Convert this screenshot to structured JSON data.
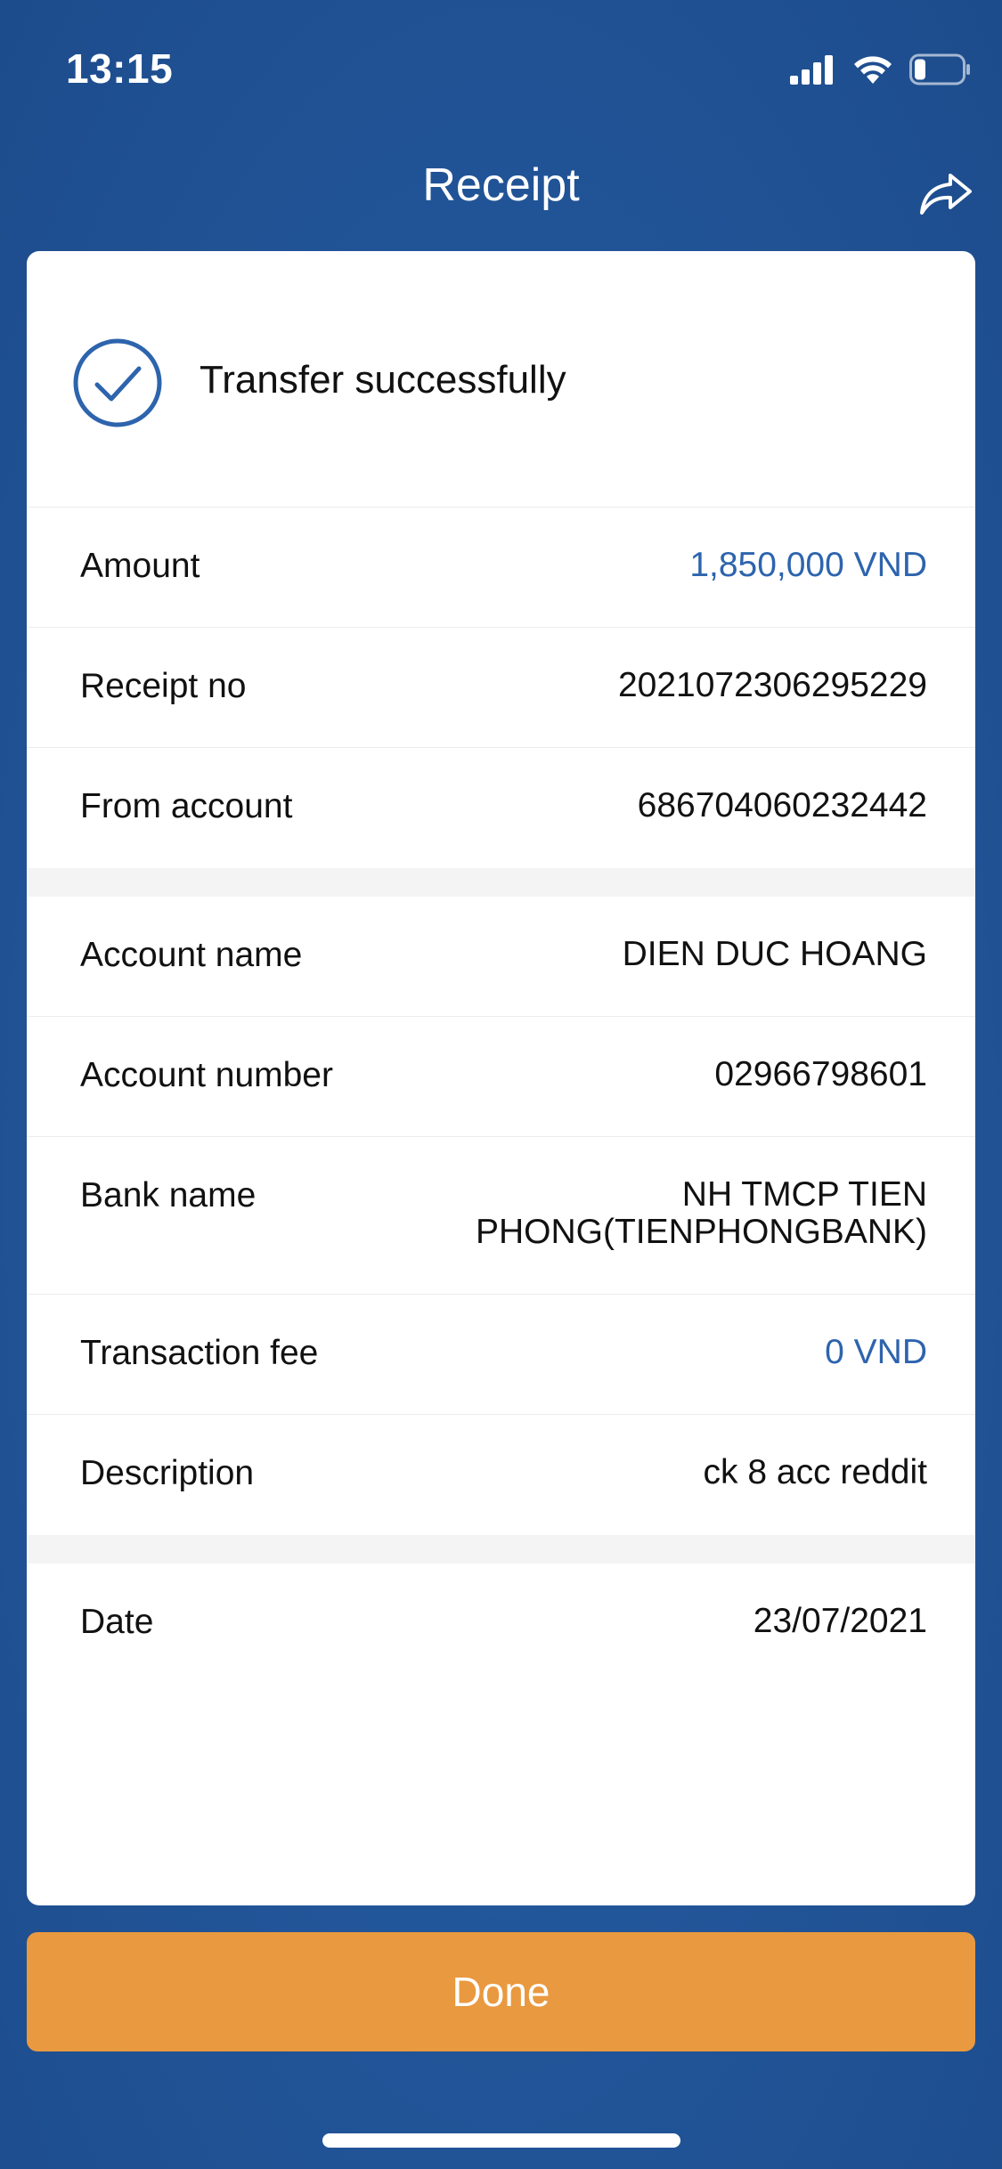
{
  "status_bar": {
    "time": "13:15"
  },
  "header": {
    "title": "Receipt"
  },
  "status": {
    "message": "Transfer successfully"
  },
  "details": [
    {
      "label": "Amount",
      "value": "1,850,000 VND",
      "accent": true
    },
    {
      "label": "Receipt no",
      "value": "2021072306295229",
      "accent": false
    },
    {
      "label": "From account",
      "value": "686704060232442",
      "accent": false
    }
  ],
  "beneficiary": [
    {
      "label": "Account name",
      "value": "DIEN DUC HOANG",
      "accent": false
    },
    {
      "label": "Account number",
      "value": "02966798601",
      "accent": false
    },
    {
      "label": "Bank name",
      "value": "NH TMCP TIEN PHONG(TIENPHONGBANK)",
      "accent": false
    },
    {
      "label": "Transaction fee",
      "value": "0 VND",
      "accent": true
    },
    {
      "label": "Description",
      "value": "ck 8 acc reddit",
      "accent": false
    }
  ],
  "date": {
    "label": "Date",
    "value": "23/07/2021"
  },
  "actions": {
    "done_label": "Done"
  },
  "icons": {
    "signal": "cellular-signal-icon",
    "wifi": "wifi-icon",
    "battery": "battery-icon",
    "share": "share-icon",
    "success": "checkmark-circle-icon"
  },
  "colors": {
    "background": "#22569a",
    "accent": "#2d64ad",
    "button": "#e9993f"
  }
}
